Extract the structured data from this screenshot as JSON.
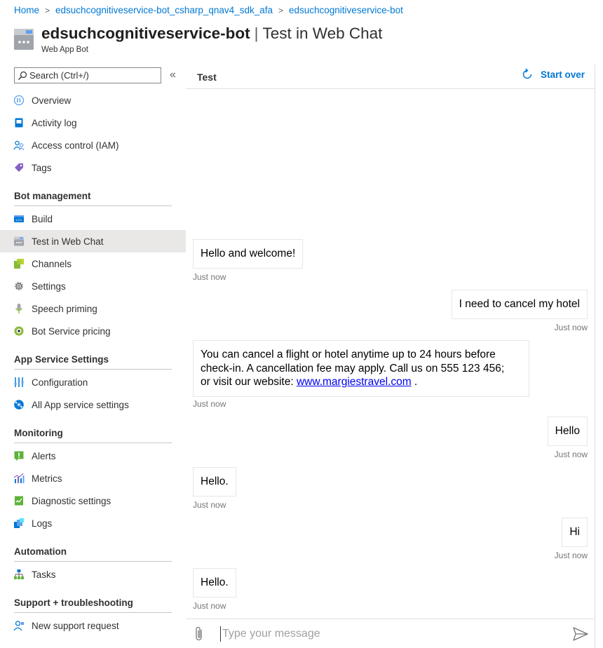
{
  "breadcrumb": [
    "Home",
    "edsuchcognitiveservice-bot_csharp_qnav4_sdk_afa",
    "edsuchcognitiveservice-bot"
  ],
  "header": {
    "title_bold": "edsuchcognitiveservice-bot",
    "title_sep": "|",
    "title_rest": "Test in Web Chat",
    "subtitle": "Web App Bot",
    "icon": "web-app-bot-icon"
  },
  "sidebar": {
    "search_placeholder": "Search (Ctrl+/)",
    "collapse": "«",
    "top_items": [
      {
        "label": "Overview",
        "icon": "overview-icon"
      },
      {
        "label": "Activity log",
        "icon": "activity-log-icon"
      },
      {
        "label": "Access control (IAM)",
        "icon": "iam-icon"
      },
      {
        "label": "Tags",
        "icon": "tag-icon"
      }
    ],
    "sections": [
      {
        "title": "Bot management",
        "items": [
          {
            "label": "Build",
            "icon": "build-icon"
          },
          {
            "label": "Test in Web Chat",
            "icon": "web-chat-icon",
            "active": true
          },
          {
            "label": "Channels",
            "icon": "channels-icon"
          },
          {
            "label": "Settings",
            "icon": "gear-icon"
          },
          {
            "label": "Speech priming",
            "icon": "microphone-icon"
          },
          {
            "label": "Bot Service pricing",
            "icon": "pricing-icon"
          }
        ]
      },
      {
        "title": "App Service Settings",
        "items": [
          {
            "label": "Configuration",
            "icon": "configuration-icon"
          },
          {
            "label": "All App service settings",
            "icon": "app-service-icon"
          }
        ]
      },
      {
        "title": "Monitoring",
        "items": [
          {
            "label": "Alerts",
            "icon": "alert-icon"
          },
          {
            "label": "Metrics",
            "icon": "metrics-icon"
          },
          {
            "label": "Diagnostic settings",
            "icon": "diagnostic-icon"
          },
          {
            "label": "Logs",
            "icon": "logs-icon"
          }
        ]
      },
      {
        "title": "Automation",
        "items": [
          {
            "label": "Tasks",
            "icon": "tasks-icon"
          }
        ]
      },
      {
        "title": "Support + troubleshooting",
        "items": [
          {
            "label": "New support request",
            "icon": "support-icon"
          }
        ]
      }
    ]
  },
  "panel": {
    "title": "Test",
    "start_over": "Start over"
  },
  "chat": {
    "messages": [
      {
        "from": "bot",
        "text": "Hello and welcome!",
        "time": "Just now"
      },
      {
        "from": "user",
        "text": "I need to cancel my hotel",
        "time": "Just now"
      },
      {
        "from": "bot",
        "text_line1": "You can cancel a flight or hotel anytime up to 24 hours before",
        "text_line2": "check-in. A cancellation fee may apply. Call us on 555 123 456;",
        "text_line3_pre": "or visit our website: ",
        "link": "www.margiestravel.com",
        "text_line3_post": " .",
        "time": "Just now"
      },
      {
        "from": "user",
        "text": "Hello",
        "time": "Just now"
      },
      {
        "from": "bot",
        "text": "Hello.",
        "time": "Just now"
      },
      {
        "from": "user",
        "text": "Hi",
        "time": "Just now"
      },
      {
        "from": "bot",
        "text": "Hello.",
        "time": "Just now"
      }
    ],
    "input_placeholder": "Type your message"
  },
  "colors": {
    "accent": "#0078d4",
    "active_bg": "#e9e8e7",
    "link": "#0000ee"
  }
}
